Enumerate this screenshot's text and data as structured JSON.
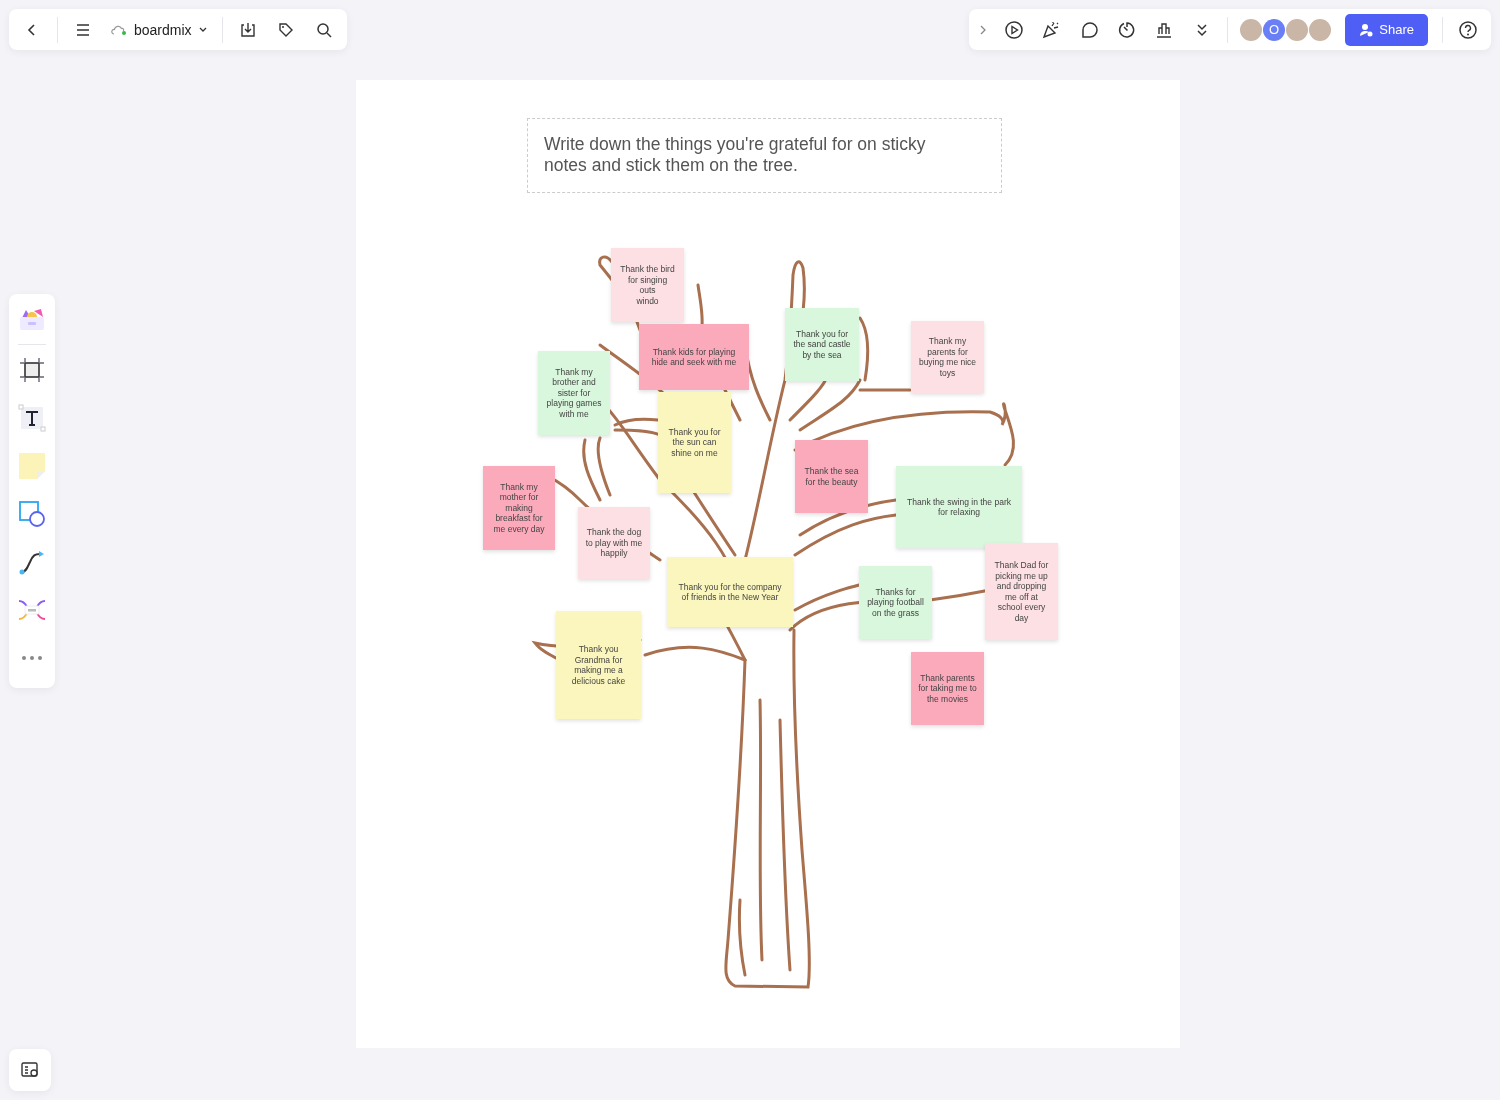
{
  "top_bar": {
    "app_name": "boardmix"
  },
  "collaborators": [
    {
      "kind": "photo"
    },
    {
      "kind": "letter",
      "letter": "O"
    },
    {
      "kind": "photo"
    },
    {
      "kind": "photo"
    }
  ],
  "share_button": "Share",
  "instruction": "Write down the things you're grateful for on sticky notes and stick them on the tree.",
  "notes": [
    {
      "text": "Thank the bird\nfor singing\nouts\nwindo",
      "color": "#fde0e3"
    },
    {
      "text": "Thank kids for playing hide and seek with me",
      "color": "#fbaabb"
    },
    {
      "text": "Thank you for the sand castle by the sea",
      "color": "#d9f7dc"
    },
    {
      "text": "Thank my parents for buying me nice toys",
      "color": "#fde0e3"
    },
    {
      "text": "Thank my brother and sister for playing games with me",
      "color": "#d9f7dc"
    },
    {
      "text": "Thank you for the sun can shine on me",
      "color": "#fbf6bd"
    },
    {
      "text": "Thank the sea for the beauty",
      "color": "#fbaabb"
    },
    {
      "text": "Thank my mother for making breakfast for me every day",
      "color": "#fbaabb"
    },
    {
      "text": "Thank the swing in the park for relaxing",
      "color": "#d9f7dc"
    },
    {
      "text": "Thank the dog to play with me happily",
      "color": "#fde0e3"
    },
    {
      "text": "Thank you for the company of friends in the New Year",
      "color": "#fbf6bd"
    },
    {
      "text": "Thanks for playing football on the grass",
      "color": "#d9f7dc"
    },
    {
      "text": "Thank Dad for picking me up and dropping me off at school every day",
      "color": "#fde0e3"
    },
    {
      "text": "Thank you Grandma for making me a delicious cake",
      "color": "#fbf6bd"
    },
    {
      "text": "Thank parents for taking me to the movies",
      "color": "#fbaabb"
    }
  ]
}
